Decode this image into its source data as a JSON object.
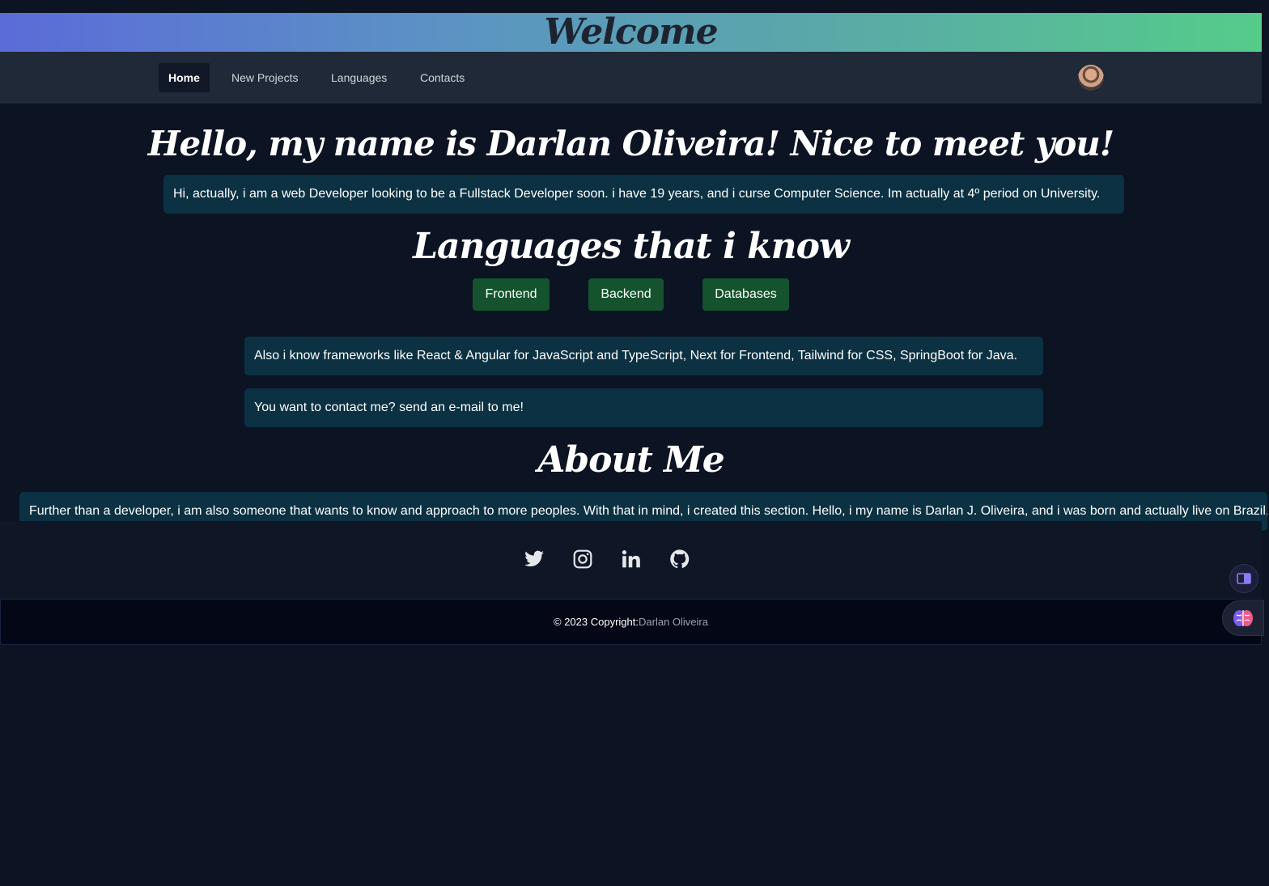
{
  "header": {
    "title": "Welcome"
  },
  "nav": {
    "items": [
      {
        "label": "Home",
        "active": true
      },
      {
        "label": "New Projects",
        "active": false
      },
      {
        "label": "Languages",
        "active": false
      },
      {
        "label": "Contacts",
        "active": false
      }
    ],
    "avatar_icon": "user-avatar"
  },
  "intro": {
    "headline": "Hello, my name is Darlan Oliveira! Nice to meet you!",
    "text": "Hi, actually, i am a web Developer looking to be a Fullstack Developer soon. i have 19 years, and i curse Computer Science. Im actually at 4º period on University."
  },
  "languages": {
    "title": "Languages that i know",
    "buttons": [
      "Frontend",
      "Backend",
      "Databases"
    ],
    "frameworks_text": "Also i know frameworks like React & Angular for JavaScript and TypeScript, Next for Frontend, Tailwind for CSS, SpringBoot for Java.",
    "contact_text": "You want to contact me? send an e-mail to me!"
  },
  "about": {
    "title": "About Me",
    "text": "Further than a developer, i am also someone that wants to know and approach to more peoples. With that in mind, i created this section. Hello, i my name is Darlan J. Oliveira, and i was born and actually live on Brazil,"
  },
  "social": {
    "icons": [
      "twitter-icon",
      "instagram-icon",
      "linkedin-icon",
      "github-icon"
    ]
  },
  "footer": {
    "copyright": "© 2023 Copyright:",
    "author": "Darlan Oliveira"
  },
  "floating": {
    "icons": [
      "reader-icon",
      "brain-icon"
    ]
  },
  "colors": {
    "background": "#0c1322",
    "navbar": "#1f2937",
    "info_box": "#0b3142",
    "language_button": "#14532d",
    "gradient_start": "#5b6bd9",
    "gradient_end": "#55cc8a"
  }
}
